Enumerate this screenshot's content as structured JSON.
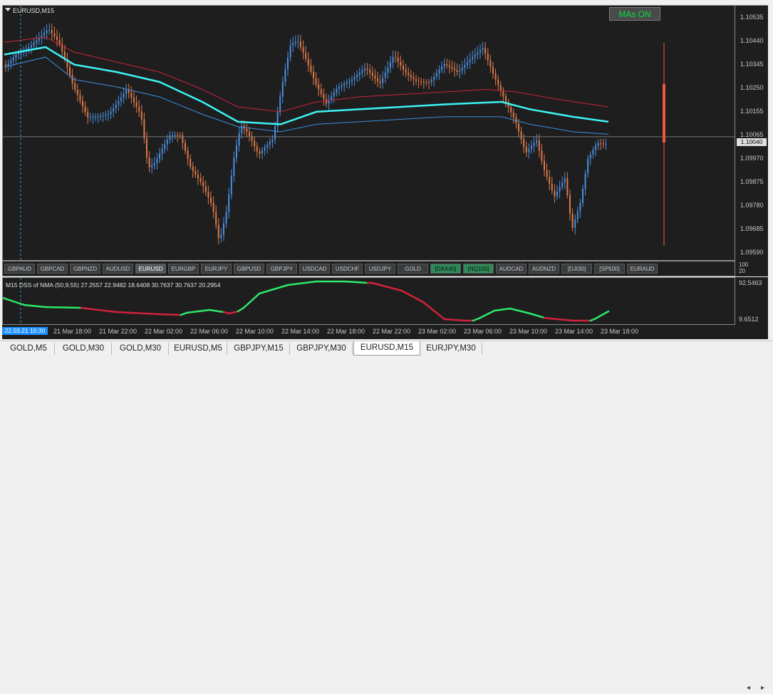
{
  "chart": {
    "title": "EURUSD,M15",
    "mas_button": "MAs ON",
    "current_price": "1.10040",
    "crosshair_time": "22.03.21 15:30",
    "colors": {
      "background": "#1e1e1e",
      "bull_candle": "#4a90e2",
      "bear_candle": "#e07a4a",
      "ma_fast": "#3df2f2",
      "ma_mid": "#3a8fe0",
      "ma_slow": "#c8243c",
      "dss_up": "#2ee86a",
      "dss_down": "#d0223c",
      "crosshair": "#2aa5e6",
      "volume_bar": "#f05a3c"
    }
  },
  "price_axis": {
    "labels": [
      "1.10535",
      "1.10440",
      "1.10345",
      "1.10250",
      "1.10155",
      "1.10065",
      "1.09970",
      "1.09875",
      "1.09780",
      "1.09685",
      "1.09590"
    ]
  },
  "symbol_buttons": [
    {
      "label": "GBPAUD",
      "style": "normal"
    },
    {
      "label": "GBPCAD",
      "style": "normal"
    },
    {
      "label": "GBPNZD",
      "style": "normal"
    },
    {
      "label": "AUDUSD",
      "style": "normal"
    },
    {
      "label": "EURUSD",
      "style": "active"
    },
    {
      "label": "EURGBP",
      "style": "normal"
    },
    {
      "label": "EURJPY",
      "style": "normal"
    },
    {
      "label": "GBPUSD",
      "style": "normal"
    },
    {
      "label": "GBPJPY",
      "style": "normal"
    },
    {
      "label": "USDCAD",
      "style": "normal"
    },
    {
      "label": "USDCHF",
      "style": "normal"
    },
    {
      "label": "USDJPY",
      "style": "normal"
    },
    {
      "label": "GOLD",
      "style": "normal"
    },
    {
      "label": "[DAX40]",
      "style": "green"
    },
    {
      "label": "[NQ100]",
      "style": "green"
    },
    {
      "label": "AUDCAD",
      "style": "normal"
    },
    {
      "label": "AUDNZD",
      "style": "normal"
    },
    {
      "label": "[DJI30]",
      "style": "normal"
    },
    {
      "label": "[SP500]",
      "style": "normal"
    },
    {
      "label": "EURAUD",
      "style": "normal"
    }
  ],
  "button_axis": {
    "top": "100",
    "bottom": "20"
  },
  "indicator": {
    "title": "M15 DSS of NMA (50,9,55) 27.2557 22.9482 18.6408 30.7637 30.7637 20.2954",
    "max_label": "92.5463",
    "min_label": "9.6512"
  },
  "time_axis": {
    "labels": [
      "21 Mar 18:00",
      "21 Mar 22:00",
      "22 Mar 02:00",
      "22 Mar 06:00",
      "22 Mar 10:00",
      "22 Mar 14:00",
      "22 Mar 18:00",
      "22 Mar 22:00",
      "23 Mar 02:00",
      "23 Mar 06:00",
      "23 Mar 10:00",
      "23 Mar 14:00",
      "23 Mar 18:00"
    ]
  },
  "tabs": [
    {
      "label": "GOLD,M5",
      "active": false
    },
    {
      "label": "GOLD,M30",
      "active": false
    },
    {
      "label": "GOLD,M30",
      "active": false
    },
    {
      "label": "EURUSD,M5",
      "active": false
    },
    {
      "label": "GBPJPY,M15",
      "active": false
    },
    {
      "label": "GBPJPY,M30",
      "active": false
    },
    {
      "label": "EURUSD,M15",
      "active": true
    },
    {
      "label": "EURJPY,M30",
      "active": false
    }
  ],
  "scroll": {
    "left_icon": "chevron-left-icon",
    "right_icon": "chevron-right-icon",
    "left_glyph": "◂",
    "right_glyph": "▸"
  }
}
